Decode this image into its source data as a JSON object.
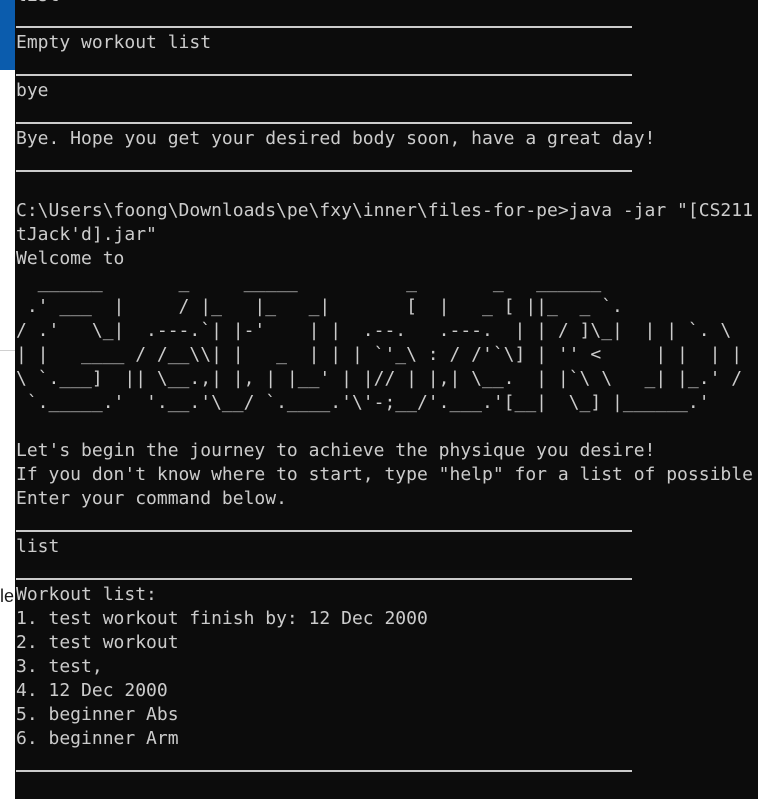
{
  "terminal": {
    "text_color": "#cccccc",
    "background": "#0c0c0c",
    "partial_top_line": "list",
    "empty_list_message": "Empty workout list",
    "bye_command": "bye",
    "bye_message": "Bye. Hope you get your desired body soon, have a great day!",
    "run_command_line1": "C:\\Users\\foong\\Downloads\\pe\\fxy\\inner\\files-for-pe>java -jar \"[CS211",
    "run_command_line2": "tJack'd].jar\"",
    "welcome": "Welcome to",
    "banner": [
      "  ______       _     _____          _       _   ______",
      " .' ___  |     / |_   |_   _|       [  |   _ [ ||_  _ `.",
      "/ .'   \\_|  .---.`| |-'    | |  .--.   .---.  | | / ]\\_|  | | `. \\",
      "| |   ____ / /__\\\\| |   _  | | | `'_\\ : / /'`\\] | '' <     | |  | |",
      "\\ `.___]  || \\__.,| |, | |__' | |// | |,| \\__.  | |`\\ \\   _| |_.' /",
      " `._____.'  '.__.'\\__/ `.____.'\\'-;__/'.___.'[__|  \\_] |______.'"
    ],
    "intro_line1": "Let's begin the journey to achieve the physique you desire!",
    "intro_line2": "If you don't know where to start, type \"help\" for a list of possible",
    "intro_line3": "Enter your command below.",
    "list_command": "list",
    "workout_list_header": "Workout list:",
    "workout_items": [
      "1. test workout finish by: 12 Dec 2000",
      "2. test workout",
      "3. test,",
      "4. 12 Dec 2000",
      "5. beginner Abs",
      "6. beginner Arm"
    ]
  },
  "background_window": {
    "peek_text": "le"
  }
}
